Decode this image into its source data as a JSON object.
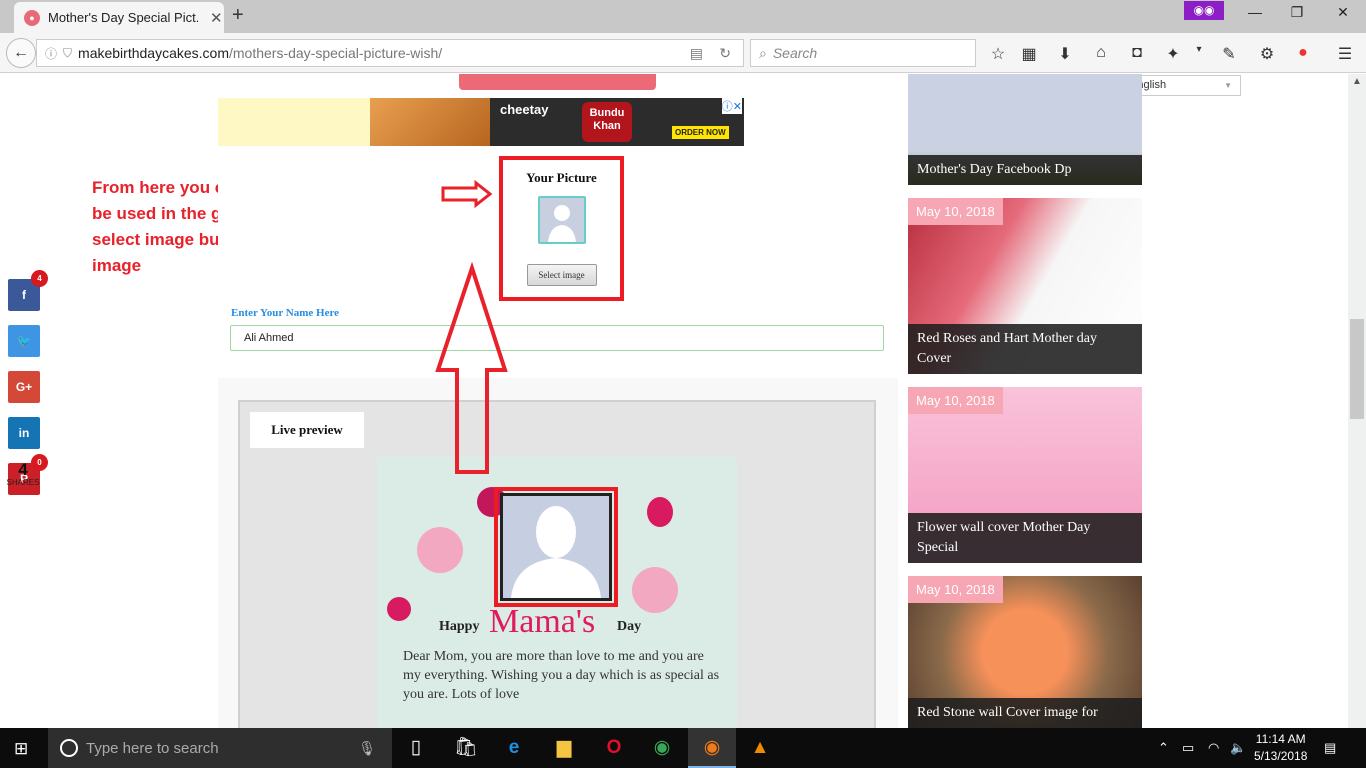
{
  "browser": {
    "tab_title": "Mother's Day Special Pict...",
    "new_tab_icon": "plus-icon",
    "url_host": "makebirthdaycakes.com",
    "url_path": "/mothers-day-special-picture-wish/",
    "search_placeholder": "Search",
    "window_controls": {
      "minimize": "—",
      "restore": "❐",
      "close": "✕"
    }
  },
  "ad": {
    "brand": "cheetay",
    "restaurant": "Bundu Khan",
    "cta": "ORDER NOW"
  },
  "annotation": {
    "text": "From here you can change the picture to be used in the generated image.click on select image button to upload the desired image",
    "color": "#e8212a"
  },
  "form": {
    "picture_label": "Your Picture",
    "select_button": "Select image",
    "name_label": "Enter Your Name Here",
    "name_value": "Ali Ahmed"
  },
  "preview": {
    "tab_label": "Live preview",
    "happy": "Happy",
    "mama": "Mama's",
    "day": "Day",
    "message": "Dear Mom, you are more than love to me and you are my everything. Wishing you a day which is as special as you are. Lots of love"
  },
  "social": {
    "buttons": [
      {
        "network": "facebook",
        "glyph": "f",
        "color": "#3b5998",
        "count": "4"
      },
      {
        "network": "twitter",
        "glyph": "t",
        "color": "#3d95e4"
      },
      {
        "network": "google-plus",
        "glyph": "G+",
        "color": "#d34836"
      },
      {
        "network": "linkedin",
        "glyph": "in",
        "color": "#1474b4"
      },
      {
        "network": "pinterest",
        "glyph": "P",
        "color": "#cb2027",
        "count": "0"
      }
    ],
    "total": "4",
    "total_label": "SHARES"
  },
  "language": {
    "selected": "English"
  },
  "sidebar": {
    "posts": [
      {
        "date": "",
        "title": "Mother's Day Facebook Dp"
      },
      {
        "date": "May 10, 2018",
        "title": "Red Roses and Hart Mother day Cover"
      },
      {
        "date": "May 10, 2018",
        "title": "Flower wall cover Mother Day Special"
      },
      {
        "date": "May 10, 2018",
        "title": "Red Stone wall Cover image for"
      }
    ]
  },
  "taskbar": {
    "search_placeholder": "Type here to search",
    "time": "11:14 AM",
    "date": "5/13/2018"
  }
}
